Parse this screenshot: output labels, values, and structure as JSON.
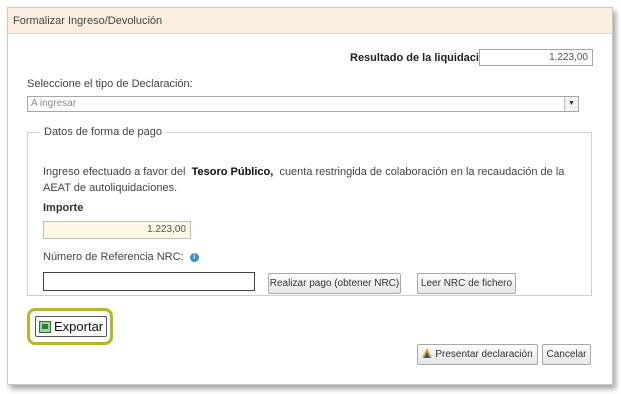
{
  "dialog": {
    "title": "Formalizar Ingreso/Devolución",
    "result_label": "Resultado de la liquidación",
    "result_value": "1.223,00",
    "select_label": "Seleccione el tipo de Declaración:",
    "select_value": "A ingresar",
    "payment_section": {
      "legend": "Datos de forma de pago",
      "info_prefix": "Ingreso efectuado a favor del",
      "info_bold": "Tesoro Público,",
      "info_suffix": "cuenta restringida de colaboración en la recaudación de la AEAT de autoliquidaciones.",
      "importe_label": "Importe",
      "importe_value": "1.223,00",
      "nrc_label": "Número de Referencia  NRC:",
      "nrc_value": "",
      "realizar_pago_label": "Realizar pago (obtener NRC)",
      "leer_nrc_label": "Leer NRC de fichero"
    },
    "export_label": "Exportar",
    "presentar_label": "Presentar declaración",
    "cancelar_label": "Cancelar"
  },
  "icons": {
    "info": "info-icon",
    "export": "export-icon",
    "presentar": "presentar-icon",
    "dropdown": "chevron-down-icon"
  },
  "colors": {
    "titlebar": "#fbeee0",
    "importe_bg": "#fcf7e2",
    "highlight": "#b5b72a",
    "info_icon": "#3a8fd3"
  }
}
